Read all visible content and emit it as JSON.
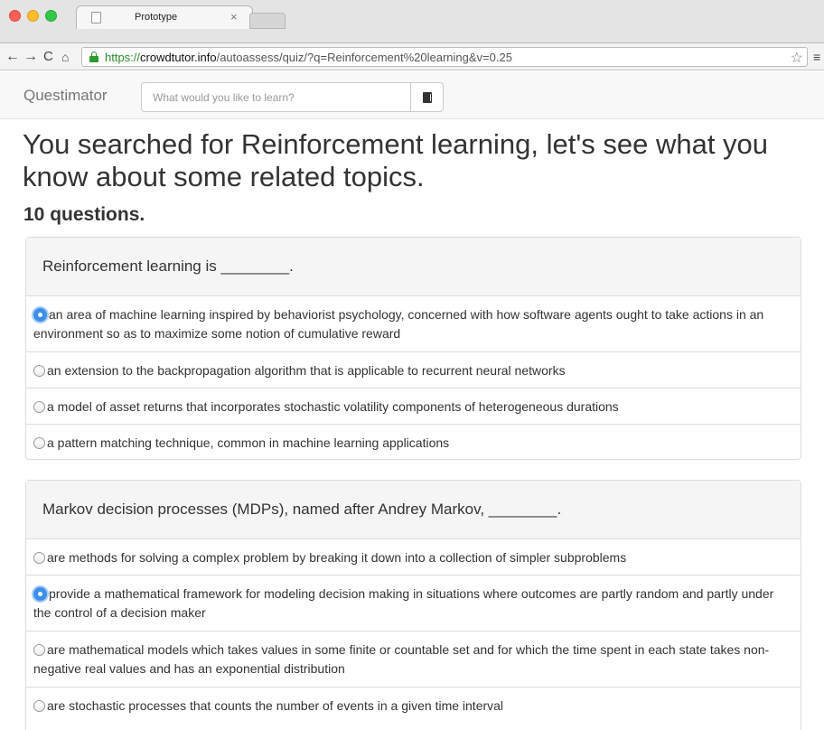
{
  "browser": {
    "tab_title": "Prototype",
    "tab_close": "×",
    "url_scheme": "https://",
    "url_host": "crowdtutor.info",
    "url_path": "/autoassess/quiz/?q=Reinforcement%20learning&v=0.25",
    "nav_back": "←",
    "nav_forward": "→",
    "nav_reload": "C",
    "nav_home": "⌂",
    "star": "☆",
    "menu": "≡"
  },
  "navbar": {
    "brand": "Questimator",
    "search_placeholder": "What would you like to learn?"
  },
  "main": {
    "headline": "You searched for Reinforcement learning, let's see what you know about some related topics.",
    "count": "10 questions."
  },
  "questions": [
    {
      "prompt": "Reinforcement learning is ________.",
      "options": [
        {
          "text": "an area of machine learning inspired by behaviorist psychology, concerned with how software agents ought to take actions in an environment so as to maximize some notion of cumulative reward",
          "selected": true
        },
        {
          "text": "an extension to the backpropagation algorithm that is applicable to recurrent neural networks",
          "selected": false
        },
        {
          "text": "a model of asset returns that incorporates stochastic volatility components of heterogeneous durations",
          "selected": false
        },
        {
          "text": "a pattern matching technique, common in machine learning applications",
          "selected": false
        }
      ]
    },
    {
      "prompt": "Markov decision processes (MDPs), named after Andrey Markov, ________.",
      "options": [
        {
          "text": "are methods for solving a complex problem by breaking it down into a collection of simpler subproblems",
          "selected": false
        },
        {
          "text": "provide a mathematical framework for modeling decision making in situations where outcomes are partly random and partly under the control of a decision maker",
          "selected": true
        },
        {
          "text": "are mathematical models which takes values in some finite or countable set and for which the time spent in each state takes non-negative real values and has an exponential distribution",
          "selected": false
        },
        {
          "text": "are stochastic processes that counts the number of events in a given time interval",
          "selected": false
        }
      ]
    }
  ]
}
